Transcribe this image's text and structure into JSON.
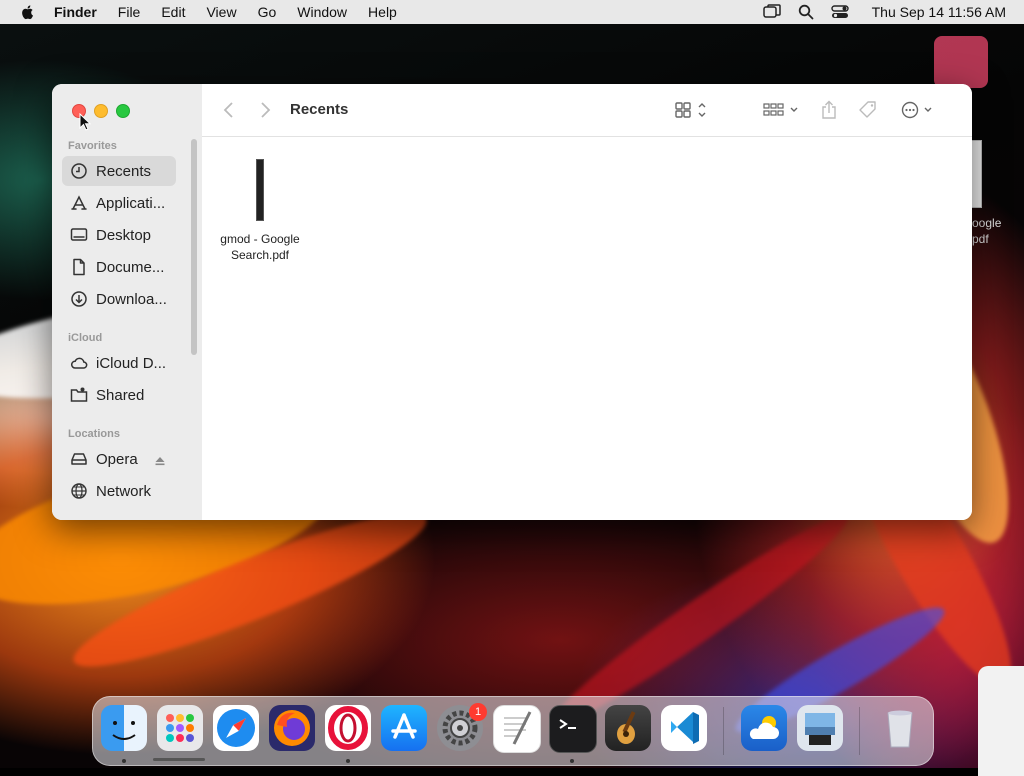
{
  "menubar": {
    "app_name": "Finder",
    "menus": [
      "File",
      "Edit",
      "View",
      "Go",
      "Window",
      "Help"
    ],
    "clock": "Thu Sep 14  11:56 AM",
    "icons": [
      "apple-icon",
      "screen-mirroring-icon",
      "spotlight-search-icon",
      "control-center-icon"
    ]
  },
  "window": {
    "title": "Recents",
    "sidebar": {
      "favorites_title": "Favorites",
      "favorites": [
        {
          "label": "Recents",
          "icon": "clock-icon",
          "selected": true
        },
        {
          "label": "Applicati...",
          "icon": "applications-icon"
        },
        {
          "label": "Desktop",
          "icon": "desktop-icon"
        },
        {
          "label": "Docume...",
          "icon": "document-icon"
        },
        {
          "label": "Downloa...",
          "icon": "download-icon"
        }
      ],
      "icloud_title": "iCloud",
      "icloud": [
        {
          "label": "iCloud D...",
          "icon": "cloud-icon"
        },
        {
          "label": "Shared",
          "icon": "shared-folder-icon"
        }
      ],
      "locations_title": "Locations",
      "locations": [
        {
          "label": "Opera",
          "icon": "drive-icon"
        },
        {
          "label": "Network",
          "icon": "globe-icon"
        }
      ]
    },
    "files": [
      {
        "name": "gmod - Google Search.pdf"
      }
    ]
  },
  "desktop": {
    "peek_label_1": "oogle",
    "peek_label_2": "pdf"
  },
  "dock": {
    "apps": [
      "Finder",
      "Launchpad",
      "Safari",
      "Firefox",
      "Opera",
      "App Store",
      "System Settings",
      "TextEdit",
      "Terminal",
      "GarageBand",
      "Visual Studio Code",
      "Weather",
      "Preview",
      "Trash"
    ],
    "settings_badge": "1"
  },
  "colors": {
    "menubar": "#e8e8e8",
    "sidebar": "#ececec",
    "selection": "#d9d9d9",
    "close": "#ff5f57",
    "minimize": "#febc2e",
    "maximize": "#28c840"
  }
}
